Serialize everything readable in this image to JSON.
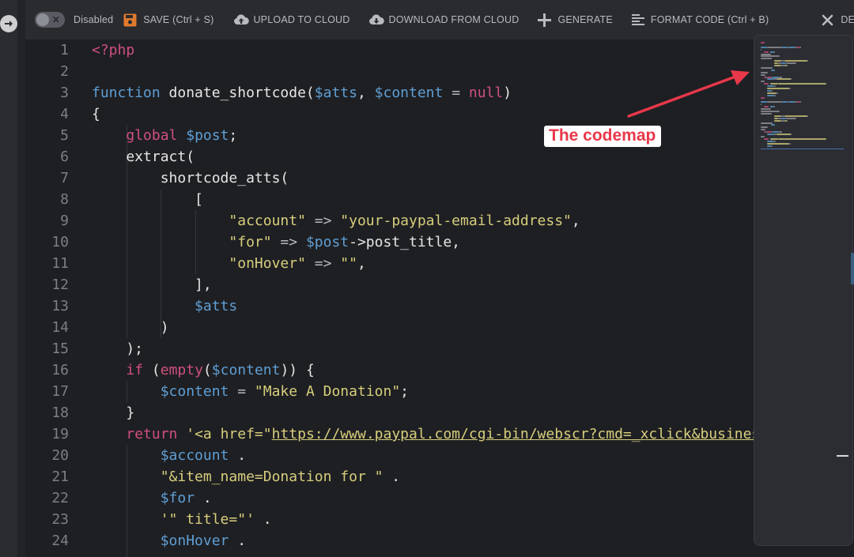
{
  "toolbar": {
    "toggle_label": "Disabled",
    "save_label": "SAVE (Ctrl + S)",
    "upload_label": "UPLOAD TO CLOUD",
    "download_label": "DOWNLOAD FROM CLOUD",
    "generate_label": "GENERATE",
    "format_label": "FORMAT CODE (Ctrl + B)",
    "delete_label": "DELETE"
  },
  "colors": {
    "accent_save": "#e07a2e",
    "keyword": "#d0507e",
    "variable": "#5f9fd4",
    "string": "#d7ce7c",
    "callout_text": "#e8384a",
    "arrow": "#e8384a"
  },
  "icons": {
    "left_rail": "arrow-right-circle-icon",
    "save": "floppy-disk-icon",
    "upload": "cloud-upload-icon",
    "download": "cloud-download-icon",
    "generate": "plus-icon",
    "format": "align-left-icon",
    "delete": "close-icon"
  },
  "editor": {
    "lines": [
      {
        "n": "1",
        "segs": [
          {
            "t": "<?php",
            "c": "kw"
          }
        ]
      },
      {
        "n": "2",
        "segs": []
      },
      {
        "n": "3",
        "segs": [
          {
            "t": "function",
            "c": "var"
          },
          {
            "t": " donate_shortcode(",
            "c": "fn"
          },
          {
            "t": "$atts",
            "c": "var"
          },
          {
            "t": ", ",
            "c": "fn"
          },
          {
            "t": "$content",
            "c": "var"
          },
          {
            "t": " = ",
            "c": "op"
          },
          {
            "t": "null",
            "c": "kw"
          },
          {
            "t": ")",
            "c": "fn"
          }
        ]
      },
      {
        "n": "4",
        "segs": [
          {
            "t": "{",
            "c": "fn"
          }
        ]
      },
      {
        "n": "5",
        "segs": [
          {
            "t": "    ",
            "c": "fn"
          },
          {
            "t": "global",
            "c": "kw"
          },
          {
            "t": " ",
            "c": "fn"
          },
          {
            "t": "$post",
            "c": "var"
          },
          {
            "t": ";",
            "c": "fn"
          }
        ]
      },
      {
        "n": "6",
        "segs": [
          {
            "t": "    extract(",
            "c": "fn"
          }
        ]
      },
      {
        "n": "7",
        "segs": [
          {
            "t": "        shortcode_atts(",
            "c": "fn"
          }
        ]
      },
      {
        "n": "8",
        "segs": [
          {
            "t": "            [",
            "c": "fn"
          }
        ]
      },
      {
        "n": "9",
        "segs": [
          {
            "t": "                ",
            "c": "fn"
          },
          {
            "t": "\"account\"",
            "c": "str"
          },
          {
            "t": " => ",
            "c": "op"
          },
          {
            "t": "\"your-paypal-email-address\"",
            "c": "str"
          },
          {
            "t": ",",
            "c": "fn"
          }
        ]
      },
      {
        "n": "10",
        "segs": [
          {
            "t": "                ",
            "c": "fn"
          },
          {
            "t": "\"for\"",
            "c": "str"
          },
          {
            "t": " => ",
            "c": "op"
          },
          {
            "t": "$post",
            "c": "var"
          },
          {
            "t": "->post_title,",
            "c": "fn"
          }
        ]
      },
      {
        "n": "11",
        "segs": [
          {
            "t": "                ",
            "c": "fn"
          },
          {
            "t": "\"onHover\"",
            "c": "str"
          },
          {
            "t": " => ",
            "c": "op"
          },
          {
            "t": "\"\"",
            "c": "str"
          },
          {
            "t": ",",
            "c": "fn"
          }
        ]
      },
      {
        "n": "12",
        "segs": [
          {
            "t": "            ],",
            "c": "fn"
          }
        ]
      },
      {
        "n": "13",
        "segs": [
          {
            "t": "            ",
            "c": "fn"
          },
          {
            "t": "$atts",
            "c": "var"
          }
        ]
      },
      {
        "n": "14",
        "segs": [
          {
            "t": "        )",
            "c": "fn"
          }
        ]
      },
      {
        "n": "15",
        "segs": [
          {
            "t": "    );",
            "c": "fn"
          }
        ]
      },
      {
        "n": "16",
        "segs": [
          {
            "t": "    ",
            "c": "fn"
          },
          {
            "t": "if",
            "c": "kw"
          },
          {
            "t": " (",
            "c": "fn"
          },
          {
            "t": "empty",
            "c": "kw"
          },
          {
            "t": "(",
            "c": "fn"
          },
          {
            "t": "$content",
            "c": "var"
          },
          {
            "t": ")) {",
            "c": "fn"
          }
        ]
      },
      {
        "n": "17",
        "segs": [
          {
            "t": "        ",
            "c": "fn"
          },
          {
            "t": "$content",
            "c": "var"
          },
          {
            "t": " = ",
            "c": "op"
          },
          {
            "t": "\"Make A Donation\"",
            "c": "str"
          },
          {
            "t": ";",
            "c": "fn"
          }
        ]
      },
      {
        "n": "18",
        "segs": [
          {
            "t": "    }",
            "c": "fn"
          }
        ]
      },
      {
        "n": "19",
        "segs": [
          {
            "t": "    ",
            "c": "fn"
          },
          {
            "t": "return",
            "c": "kw"
          },
          {
            "t": " ",
            "c": "fn"
          },
          {
            "t": "'<a href=\"",
            "c": "str"
          },
          {
            "t": "https://www.paypal.com/cgi-bin/webscr?cmd=_xclick&business",
            "c": "url"
          }
        ]
      },
      {
        "n": "20",
        "segs": [
          {
            "t": "        ",
            "c": "fn"
          },
          {
            "t": "$account",
            "c": "var"
          },
          {
            "t": " .",
            "c": "fn"
          }
        ]
      },
      {
        "n": "21",
        "segs": [
          {
            "t": "        ",
            "c": "fn"
          },
          {
            "t": "\"&item_name=Donation for \"",
            "c": "str"
          },
          {
            "t": " .",
            "c": "fn"
          }
        ]
      },
      {
        "n": "22",
        "segs": [
          {
            "t": "        ",
            "c": "fn"
          },
          {
            "t": "$for",
            "c": "var"
          },
          {
            "t": " .",
            "c": "fn"
          }
        ]
      },
      {
        "n": "23",
        "segs": [
          {
            "t": "        ",
            "c": "fn"
          },
          {
            "t": "'\" title=\"'",
            "c": "str"
          },
          {
            "t": " .",
            "c": "fn"
          }
        ]
      },
      {
        "n": "24",
        "segs": [
          {
            "t": "        ",
            "c": "fn"
          },
          {
            "t": "$onHover",
            "c": "var"
          },
          {
            "t": " .",
            "c": "fn"
          }
        ]
      }
    ]
  },
  "callout": {
    "text": "The codemap"
  }
}
